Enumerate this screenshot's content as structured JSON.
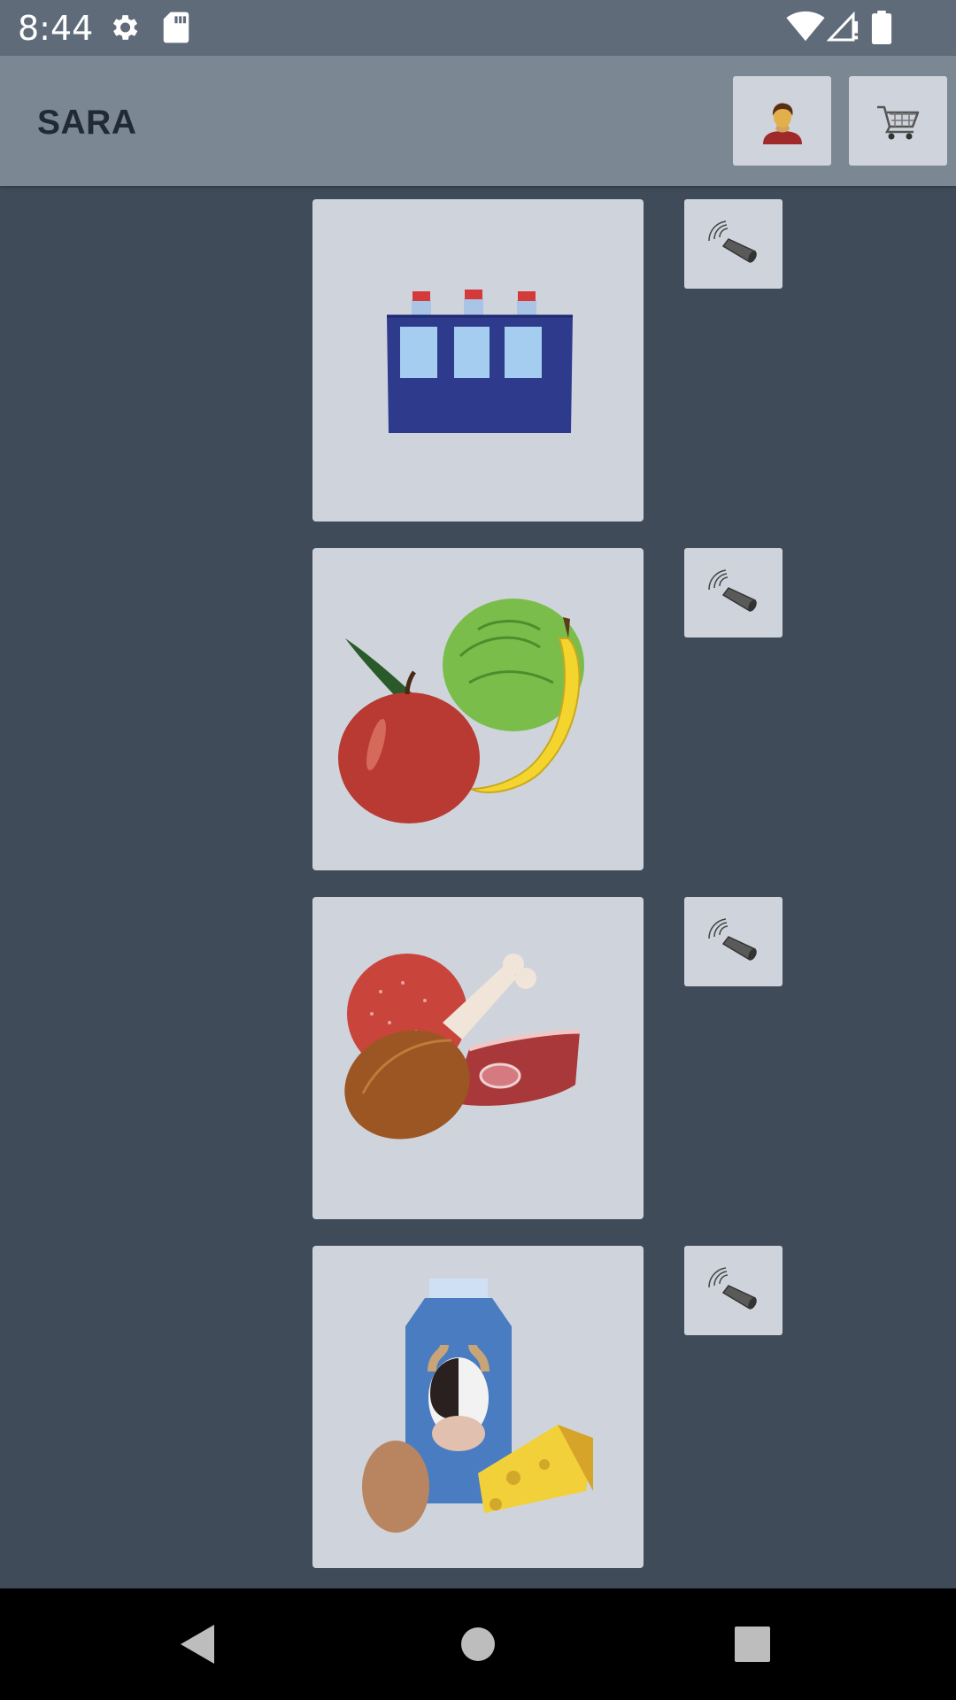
{
  "status_bar": {
    "time": "8:44",
    "icons": [
      "settings-icon",
      "sd-card-icon",
      "wifi-icon",
      "signal-icon",
      "battery-icon"
    ]
  },
  "app_bar": {
    "title": "SARA",
    "buttons": [
      {
        "icon": "user-avatar-icon"
      },
      {
        "icon": "shopping-cart-icon"
      }
    ]
  },
  "categories": [
    {
      "image": "water-bottles-crate",
      "speak_icon": "speaker-icon"
    },
    {
      "image": "fruits-vegetables",
      "speak_icon": "speaker-icon"
    },
    {
      "image": "meat-poultry",
      "speak_icon": "speaker-icon"
    },
    {
      "image": "dairy-eggs",
      "speak_icon": "speaker-icon"
    }
  ],
  "nav_bar": {
    "buttons": [
      "back-icon",
      "home-icon",
      "recents-icon"
    ]
  },
  "colors": {
    "background": "#3f4b58",
    "app_bar": "#7c8794",
    "status_bar": "#5f6b79",
    "card": "#cfd4dc",
    "title_text": "#1f2a36"
  }
}
